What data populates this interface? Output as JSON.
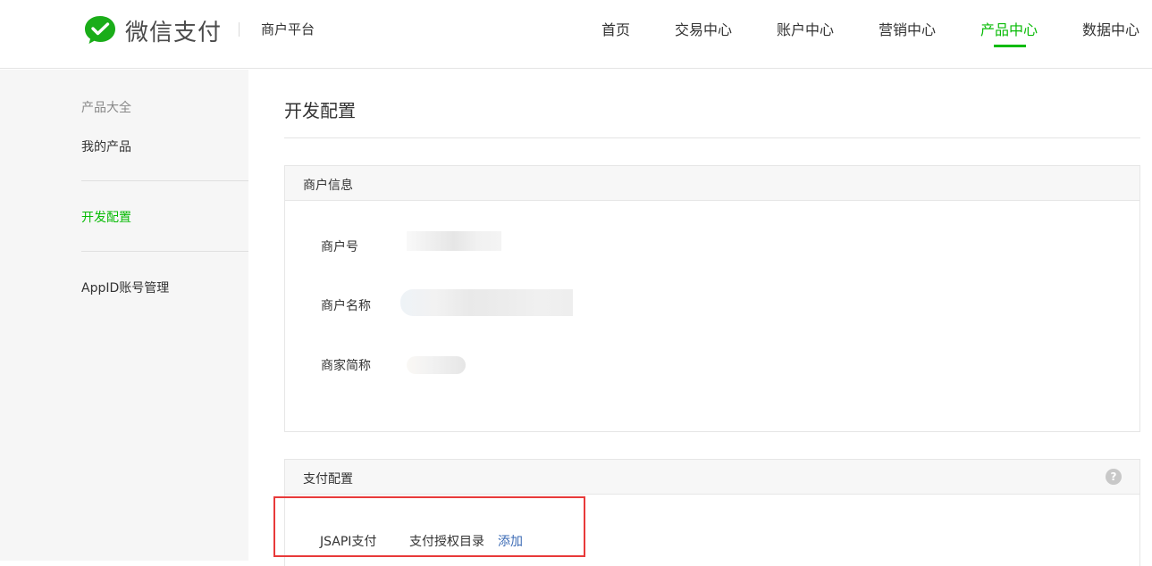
{
  "header": {
    "logo_text": "微信支付",
    "platform": "商户平台",
    "nav": [
      {
        "label": "首页"
      },
      {
        "label": "交易中心"
      },
      {
        "label": "账户中心"
      },
      {
        "label": "营销中心"
      },
      {
        "label": "产品中心"
      },
      {
        "label": "数据中心"
      }
    ],
    "active_nav": "产品中心"
  },
  "sidebar": {
    "group_label": "产品大全",
    "items": [
      {
        "label": "我的产品"
      },
      {
        "label": "开发配置"
      },
      {
        "label": "AppID账号管理"
      }
    ],
    "active_item": "开发配置"
  },
  "main": {
    "title": "开发配置",
    "merchant_info": {
      "title": "商户信息",
      "fields": [
        {
          "label": "商户号"
        },
        {
          "label": "商户名称"
        },
        {
          "label": "商家简称"
        }
      ]
    },
    "payment_config": {
      "title": "支付配置",
      "help_icon": "question-circle-icon",
      "jsapi_label": "JSAPI支付",
      "auth_dir_label": "支付授权目录",
      "add_link": "添加"
    }
  },
  "colors": {
    "accent": "#09bb07",
    "link": "#3c6bb5",
    "highlight": "#e83a3a"
  }
}
